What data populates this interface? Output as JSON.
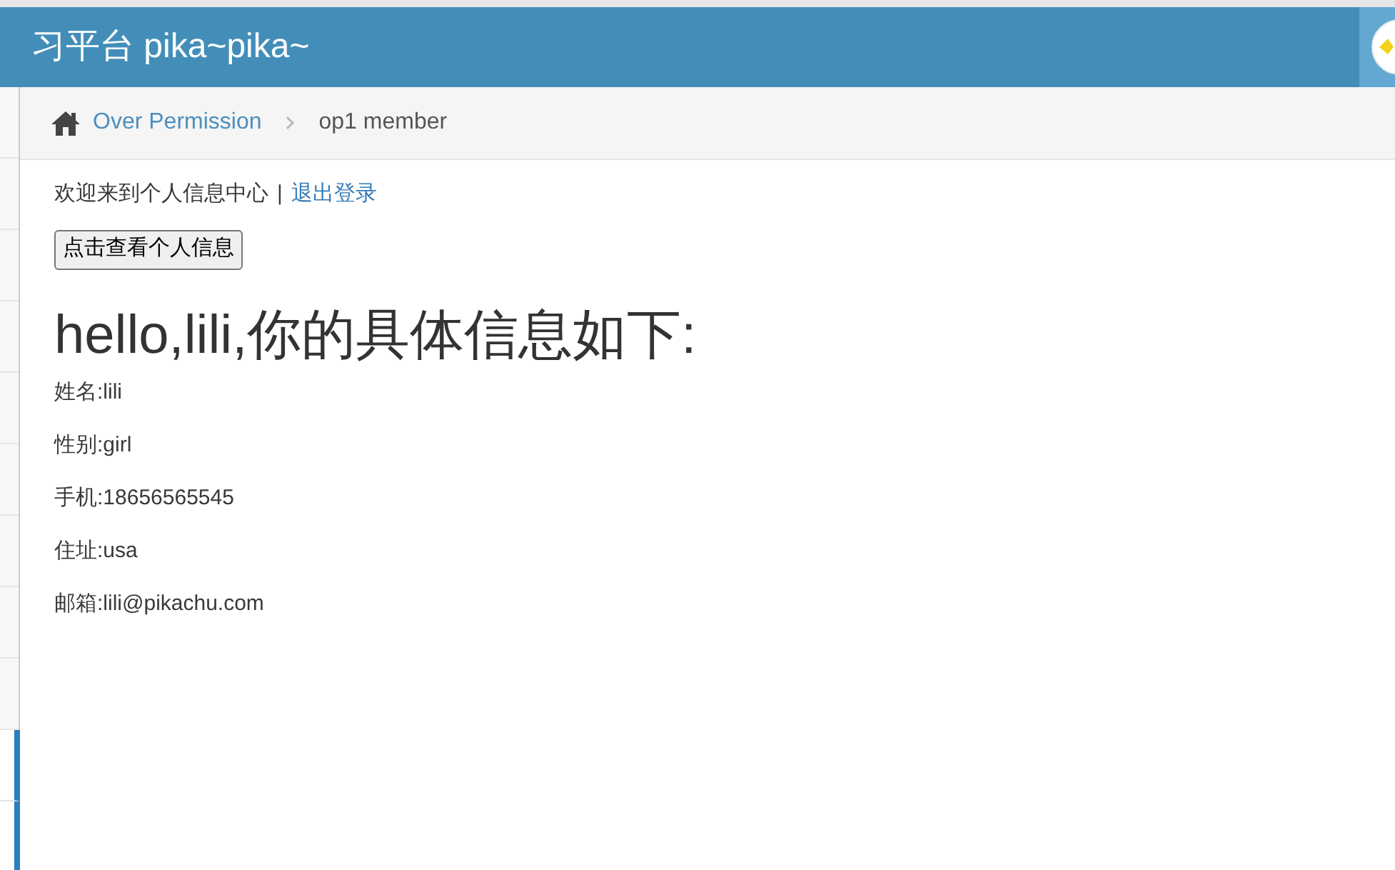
{
  "header": {
    "title": "习平台 pika~pika~"
  },
  "sidebar": {
    "items": [
      {
        "selected": false
      },
      {
        "selected": false
      },
      {
        "selected": false
      },
      {
        "selected": false
      },
      {
        "selected": false
      },
      {
        "selected": false
      },
      {
        "selected": false
      },
      {
        "selected": false
      },
      {
        "selected": false
      },
      {
        "selected": true
      },
      {
        "selected": true
      }
    ]
  },
  "breadcrumb": {
    "items": [
      {
        "label": "Over Permission",
        "kind": "link"
      },
      {
        "label": "op1 member",
        "kind": "current"
      }
    ]
  },
  "welcome": {
    "text": "欢迎来到个人信息中心",
    "separator": "|",
    "logout": "退出登录"
  },
  "button": "点击查看个人信息",
  "heading": "hello,lili,你的具体信息如下:",
  "fields": [
    "姓名:lili",
    "性别:girl",
    "手机:18656565545",
    "住址:usa",
    "邮箱:lili@pikachu.com"
  ]
}
